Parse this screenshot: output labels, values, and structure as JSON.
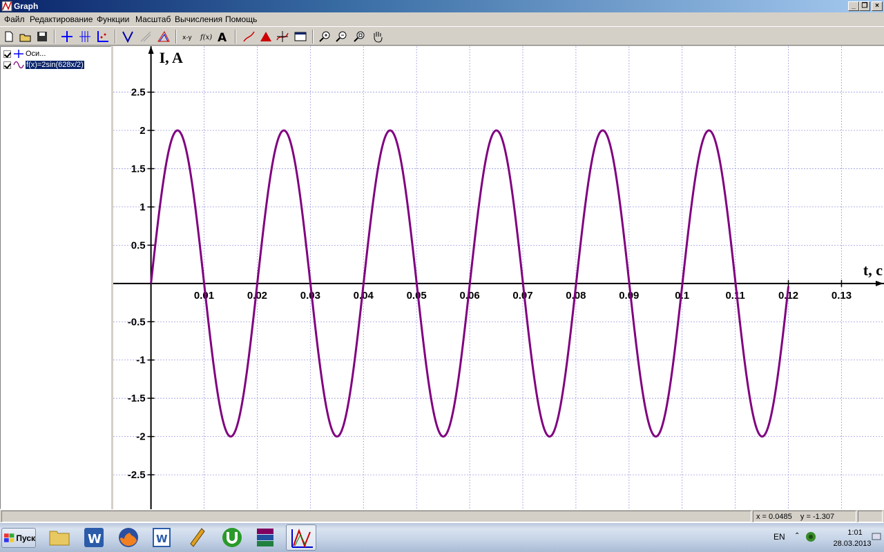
{
  "window": {
    "title": "Graph"
  },
  "menu": [
    "Файл",
    "Редактирование",
    "Функции",
    "Масштаб",
    "Вычисления",
    "Помощь"
  ],
  "toolbar": {
    "buttons": [
      "new-file-icon",
      "open-file-icon",
      "save-icon",
      "axes-icon",
      "grid-icon",
      "insert-points-icon",
      "tangent-icon",
      "normal-icon",
      "shading-icon",
      "evaluate-icon",
      "function-value-icon",
      "text-label-icon",
      "insert-graph-icon",
      "area-icon",
      "trace-icon",
      "table-icon",
      "zoom-in-icon",
      "zoom-out-icon",
      "zoom-square-icon",
      "hand-move-icon"
    ],
    "xy_label": "x-y",
    "fx_label": "f(x)",
    "text_label": "A"
  },
  "tree": {
    "items": [
      {
        "label": "Оси...",
        "checked": true,
        "icon": "axes-icon"
      },
      {
        "label": "f(x)=2sin(628x/2)",
        "checked": true,
        "icon": "sine-wave-icon",
        "selected": true
      }
    ]
  },
  "chart_data": {
    "type": "line",
    "title": "",
    "xlabel": "t, c",
    "ylabel": "I, A",
    "xlim": [
      -0.0071,
      0.138
    ],
    "ylim": [
      -2.95,
      3.1
    ],
    "grid": true,
    "xticks": [
      0.01,
      0.02,
      0.03,
      0.04,
      0.05,
      0.06,
      0.07,
      0.08,
      0.09,
      0.1,
      0.11,
      0.12,
      0.13
    ],
    "xtick_labels": [
      "0.01",
      "0.02",
      "0.03",
      "0.04",
      "0.05",
      "0.06",
      "0.07",
      "0.08",
      "0.09",
      "0.1",
      "0.11",
      "0.12",
      "0.13"
    ],
    "yticks": [
      2.5,
      2,
      1.5,
      1,
      0.5,
      -0.5,
      -1,
      -1.5,
      -2,
      -2.5
    ],
    "ytick_labels": [
      "2.5",
      "2",
      "1.5",
      "1",
      "0.5",
      "-0.5",
      "-1",
      "-1.5",
      "-2",
      "-2.5"
    ],
    "series": [
      {
        "name": "f(x)=2sin(628x/2)",
        "function": "2*sin(314*x)",
        "x_range": [
          0,
          0.12
        ],
        "color": "#800080"
      }
    ]
  },
  "status": {
    "coords": "x = 0.0485    y = -1.307"
  },
  "taskbar": {
    "start_label": "Пуск",
    "apps": [
      "folder-icon",
      "word-icon",
      "firefox-icon",
      "word-doc-icon",
      "winamp-icon",
      "utorrent-icon",
      "winrar-icon",
      "graph-app-icon"
    ],
    "lang": "EN",
    "time": "1:01",
    "date": "28.03.2013"
  }
}
